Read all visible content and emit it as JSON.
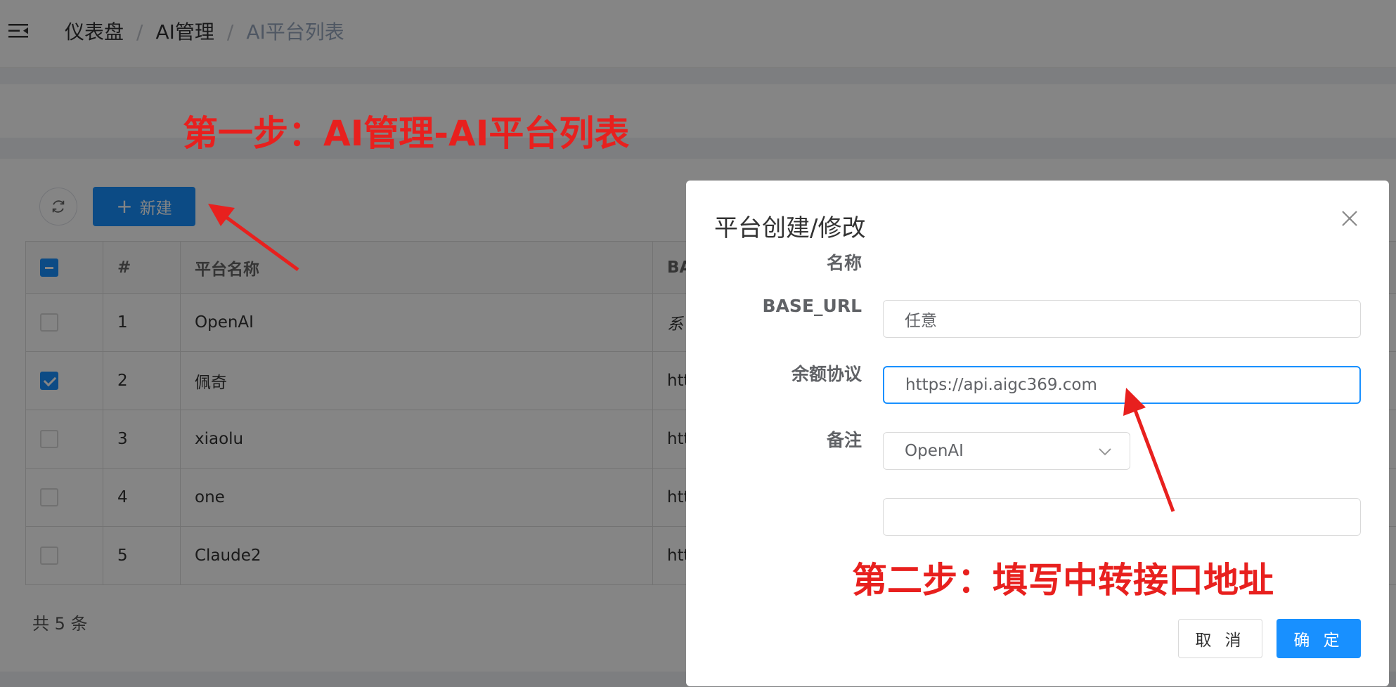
{
  "header": {
    "menu_icon": "menu-fold-icon",
    "breadcrumb": [
      "仪表盘",
      "AI管理",
      "AI平台列表"
    ]
  },
  "toolbar": {
    "refresh_icon": "refresh-icon",
    "new_icon": "plus-icon",
    "new_label": "新建"
  },
  "table": {
    "columns": [
      "#",
      "平台名称",
      "BA"
    ],
    "rows": [
      {
        "index": "1",
        "name": "OpenAI",
        "base": "系",
        "checked": false
      },
      {
        "index": "2",
        "name": "佩奇",
        "base": "htt",
        "checked": true
      },
      {
        "index": "3",
        "name": "xiaolu",
        "base": "htt",
        "checked": false
      },
      {
        "index": "4",
        "name": "one",
        "base": "htt",
        "checked": false
      },
      {
        "index": "5",
        "name": "Claude2",
        "base": "htt",
        "checked": false
      }
    ],
    "total": "共 5 条"
  },
  "annotations": {
    "step1": "第一步：AI管理-AI平台列表",
    "step2": "第二步：填写中转接口地址",
    "color": "#e8201e"
  },
  "modal": {
    "title": "平台创建/修改",
    "close_icon": "close-icon",
    "fields": {
      "name": {
        "label": "名称",
        "value": "任意"
      },
      "base_url": {
        "label": "BASE_URL",
        "value": "https://api.aigc369.com"
      },
      "balance_protocol": {
        "label": "余额协议",
        "value": "OpenAI"
      },
      "remark": {
        "label": "备注",
        "value": ""
      }
    },
    "cancel_label": "取 消",
    "confirm_label": "确 定"
  },
  "colors": {
    "primary": "#1890ff",
    "mask": "rgba(0,0,0,0.48)"
  }
}
